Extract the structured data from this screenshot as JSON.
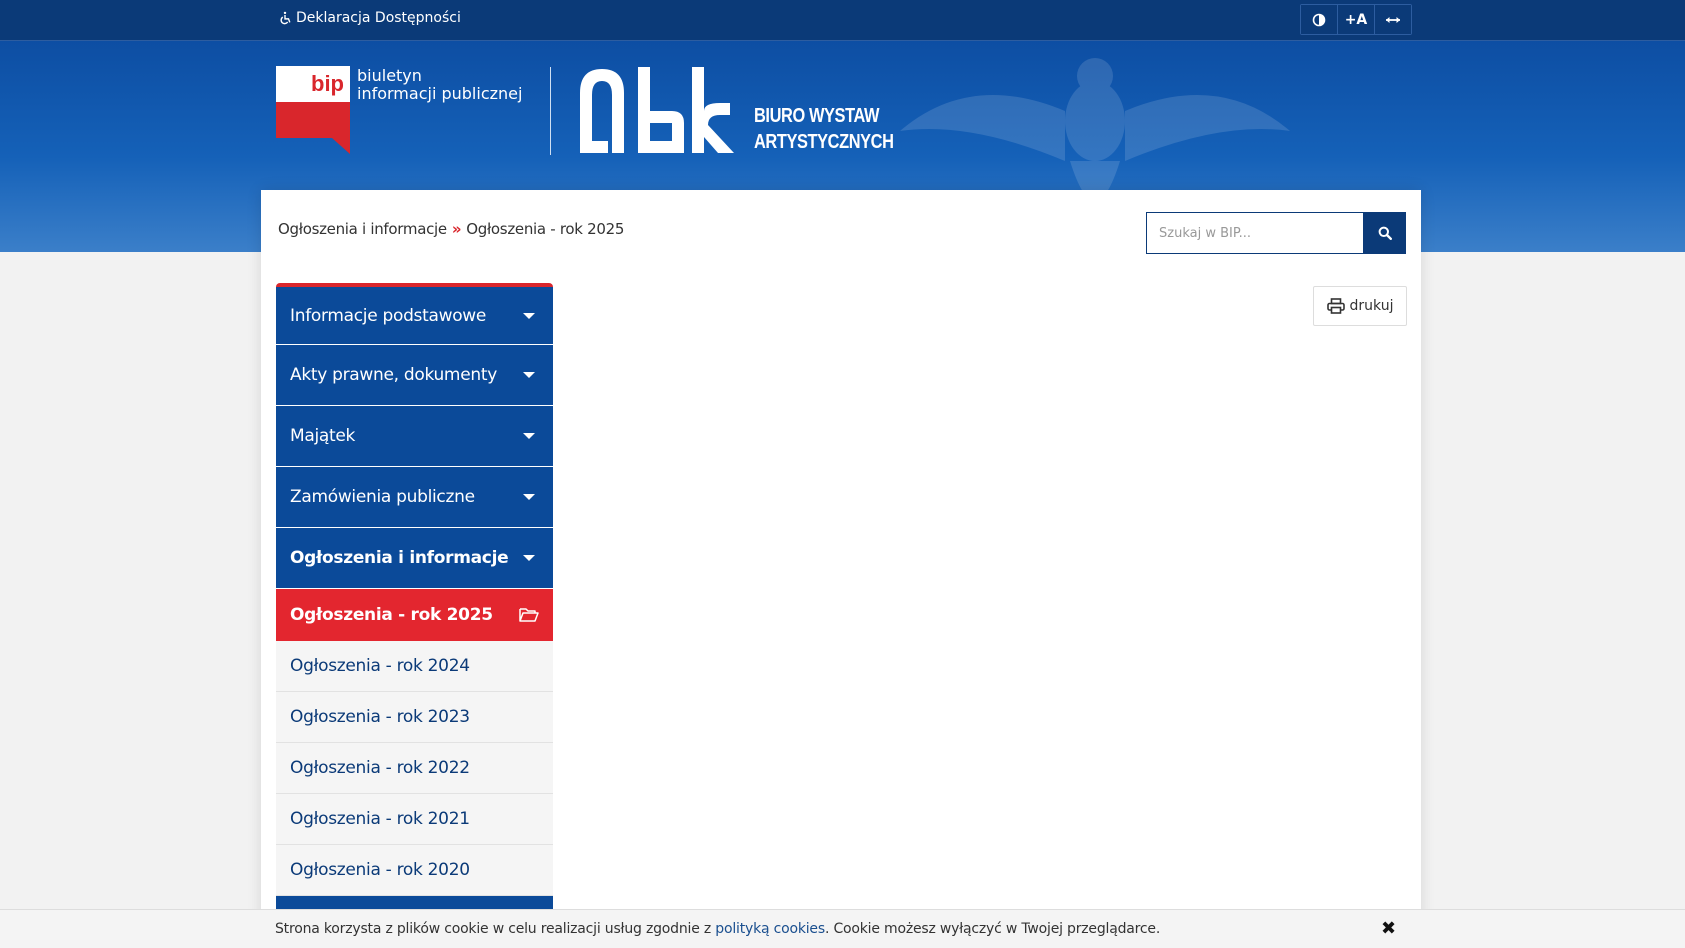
{
  "topbar": {
    "accessibility_label": "Deklaracja Dostępności",
    "tools": [
      {
        "name": "contrast-toggle",
        "icon": "contrast-icon",
        "label": "◐"
      },
      {
        "name": "font-size-increase",
        "icon": "font-size-icon",
        "label": "+A"
      },
      {
        "name": "width-toggle",
        "icon": "arrows-horizontal-icon",
        "label": "⟷"
      }
    ]
  },
  "header": {
    "bip_logo_text": "bip",
    "bip_line1": "biuletyn",
    "bip_line2": "informacji publicznej",
    "obk_line1": "BIURO WYSTAW",
    "obk_line2": "ARTYSTYCZNYCH"
  },
  "breadcrumb": {
    "items": [
      "Ogłoszenia i informacje",
      "Ogłoszenia - rok 2025"
    ],
    "separator": "»"
  },
  "search": {
    "placeholder": "Szukaj w BIP..."
  },
  "print_label": "drukuj",
  "menu": {
    "items": [
      {
        "label": "Informacje podstawowe"
      },
      {
        "label": "Akty prawne, dokumenty"
      },
      {
        "label": "Majątek"
      },
      {
        "label": "Zamówienia publiczne"
      },
      {
        "label": "Ogłoszenia i informacje"
      }
    ],
    "active_sub": "Ogłoszenia - rok 2025",
    "sub_items": [
      {
        "label": "Ogłoszenia - rok 2024"
      },
      {
        "label": "Ogłoszenia - rok 2023"
      },
      {
        "label": "Ogłoszenia - rok 2022"
      },
      {
        "label": "Ogłoszenia - rok 2021"
      },
      {
        "label": "Ogłoszenia - rok 2020"
      }
    ]
  },
  "cookie": {
    "text_before": "Strona korzysta z plików cookie w celu realizacji usług zgodnie z ",
    "link": "polityką cookies",
    "text_after": ". Cookie możesz wyłączyć w Twojej przeglądarce.",
    "close": "✖"
  },
  "colors": {
    "navy": "#0b3a78",
    "menu_blue": "#0b4a99",
    "accent_red": "#e3262f"
  }
}
